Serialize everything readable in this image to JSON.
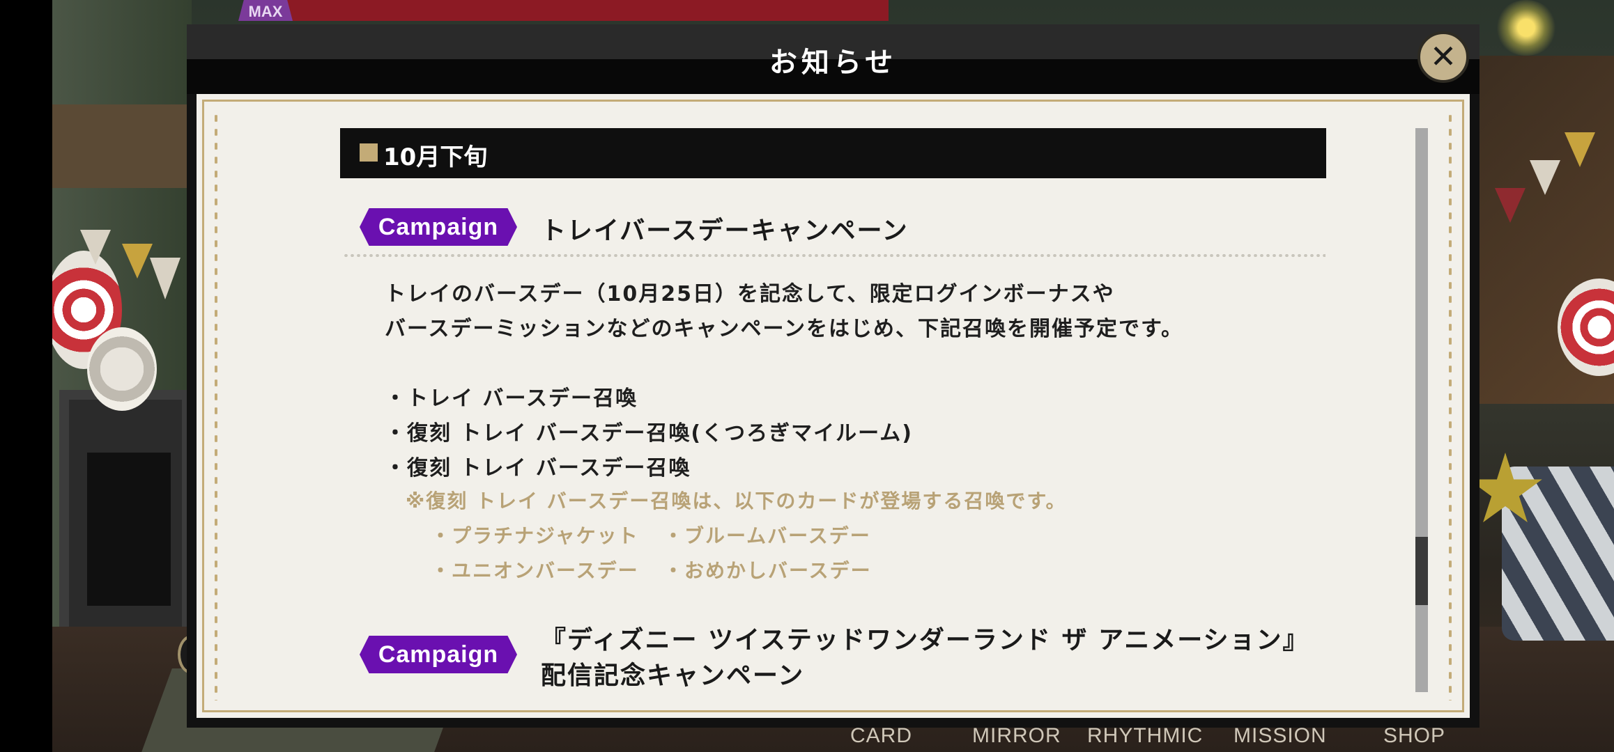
{
  "background": {
    "max_badge": "MAX",
    "bottom_nav": [
      "CARD",
      "MIRROR",
      "RHYTHMIC",
      "MISSION",
      "SHOP"
    ]
  },
  "dialog": {
    "title": "お知らせ",
    "close_icon": "close-icon",
    "section_label": "10月下旬",
    "entries": [
      {
        "tag": "Campaign",
        "title": "トレイバースデーキャンペーン",
        "body": [
          "トレイのバースデー（10月25日）を記念して、限定ログインボーナスや",
          "バースデーミッションなどのキャンペーンをはじめ、下記召喚を開催予定です。"
        ],
        "items": [
          "・トレイ バースデー召喚",
          "・復刻 トレイ バースデー召喚(くつろぎマイルーム)",
          "・復刻 トレイ バースデー召喚"
        ],
        "note": "※復刻 トレイ バースデー召喚は、以下のカードが登場する召喚です。",
        "cards": [
          "・プラチナジャケット",
          "・ブルームバースデー",
          "・ユニオンバースデー",
          "・おめかしバースデー"
        ]
      },
      {
        "tag": "Campaign",
        "title_line1": "『ディズニー ツイステッドワンダーランド ザ アニメーション』",
        "title_line2": "配信記念キャンペーン"
      }
    ]
  },
  "colors": {
    "campaign_tag": "#6a10b0",
    "accent_gold": "#c3ab77",
    "paper": "#f2f0ea"
  }
}
